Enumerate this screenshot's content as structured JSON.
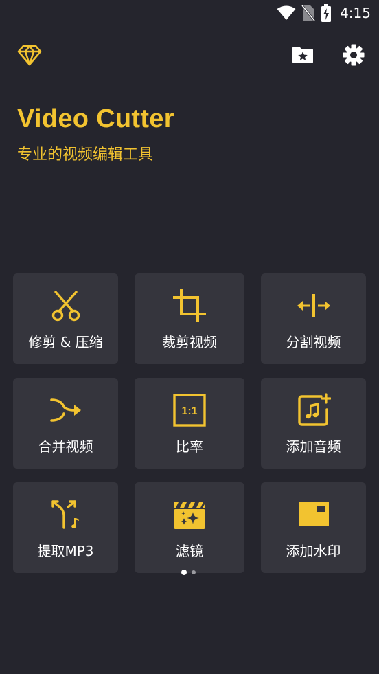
{
  "status_bar": {
    "time": "4:15"
  },
  "header": {
    "title": "Video Cutter",
    "subtitle": "专业的视频编辑工具"
  },
  "tiles": [
    {
      "label": "修剪 & 压缩",
      "icon": "scissors-icon"
    },
    {
      "label": "裁剪视频",
      "icon": "crop-icon"
    },
    {
      "label": "分割视频",
      "icon": "split-icon"
    },
    {
      "label": "合并视频",
      "icon": "merge-icon"
    },
    {
      "label": "比率",
      "icon": "ratio-icon"
    },
    {
      "label": "添加音频",
      "icon": "add-audio-icon"
    },
    {
      "label": "提取MP3",
      "icon": "extract-mp3-icon"
    },
    {
      "label": "滤镜",
      "icon": "filter-icon"
    },
    {
      "label": "添加水印",
      "icon": "watermark-icon"
    }
  ],
  "ratio_icon_text": "1:1",
  "colors": {
    "accent": "#f2c330",
    "background": "#25252d",
    "tile": "#35353d"
  },
  "pager": {
    "pages": 2,
    "current": 1
  }
}
